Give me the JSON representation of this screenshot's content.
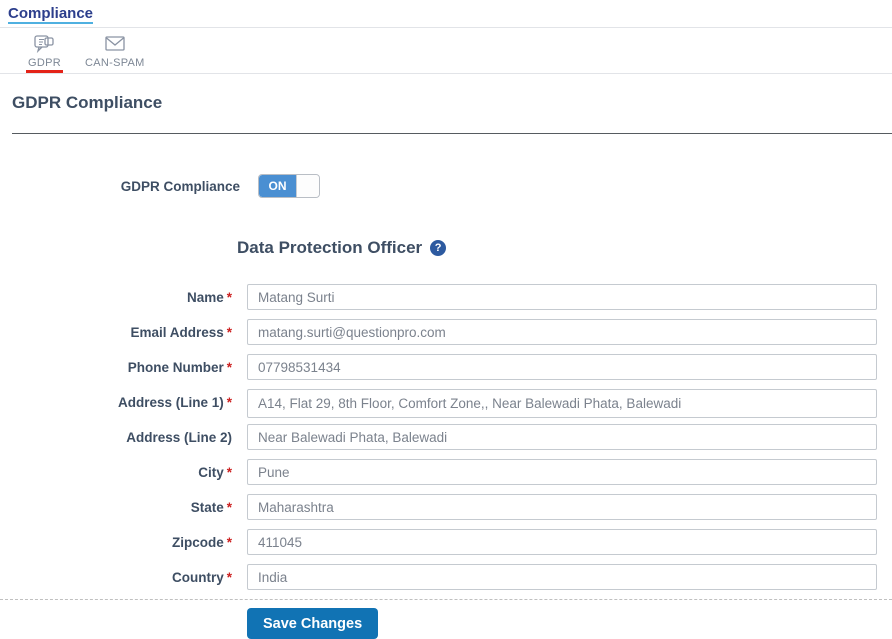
{
  "breadcrumb": {
    "label": "Compliance"
  },
  "tabs": [
    {
      "label": "GDPR",
      "icon": "gdpr-map-icon",
      "active": true
    },
    {
      "label": "CAN-SPAM",
      "icon": "envelope-icon",
      "active": false
    }
  ],
  "page": {
    "title": "GDPR Compliance"
  },
  "toggle": {
    "label": "GDPR Compliance",
    "state": "ON"
  },
  "section": {
    "title": "Data Protection Officer"
  },
  "icons": {
    "help_glyph": "?"
  },
  "form": {
    "required_marker": "*",
    "fields": [
      {
        "label": "Name",
        "required": true,
        "value": "Matang Surti"
      },
      {
        "label": "Email Address",
        "required": true,
        "value": "matang.surti@questionpro.com"
      },
      {
        "label": "Phone Number",
        "required": true,
        "value": "07798531434"
      },
      {
        "label": "Address (Line 1)",
        "required": true,
        "multiline": true,
        "value": "A14, Flat 29, 8th Floor, Comfort Zone,, Near Balewadi Phata, Balewadi"
      },
      {
        "label": "Address (Line 2)",
        "required": false,
        "value": "Near Balewadi Phata, Balewadi"
      },
      {
        "label": "City",
        "required": true,
        "value": "Pune"
      },
      {
        "label": "State",
        "required": true,
        "value": "Maharashtra"
      },
      {
        "label": "Zipcode",
        "required": true,
        "value": "411045"
      },
      {
        "label": "Country",
        "required": true,
        "value": "India"
      }
    ],
    "save_label": "Save Changes"
  },
  "colors": {
    "accent_blue": "#1173b4",
    "toggle_blue": "#4a8fd2",
    "active_tab_red": "#e42318",
    "link_blue": "#2c3e8c",
    "heading_slate": "#3e4e63",
    "required_red": "#cc1f1f"
  }
}
